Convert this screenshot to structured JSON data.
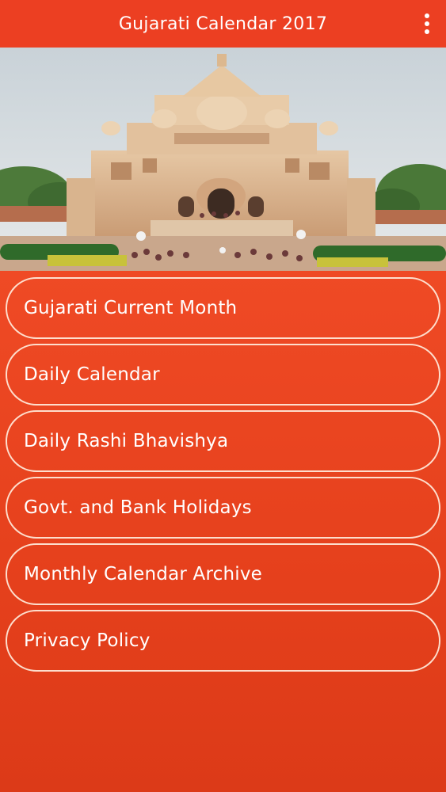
{
  "app_bar": {
    "title": "Gujarati Calendar 2017",
    "menu_icon": "more-vert-icon"
  },
  "hero": {
    "image": "temple-photo"
  },
  "menu": {
    "items": [
      {
        "label": "Gujarati Current Month"
      },
      {
        "label": "Daily Calendar"
      },
      {
        "label": "Daily Rashi Bhavishya"
      },
      {
        "label": "Govt. and Bank Holidays"
      },
      {
        "label": "Monthly Calendar Archive"
      },
      {
        "label": "Privacy Policy"
      }
    ]
  },
  "colors": {
    "app_bar": "#ec3f22",
    "background": "#e8411f",
    "button_border": "#ffebdc",
    "text": "#ffffff"
  }
}
